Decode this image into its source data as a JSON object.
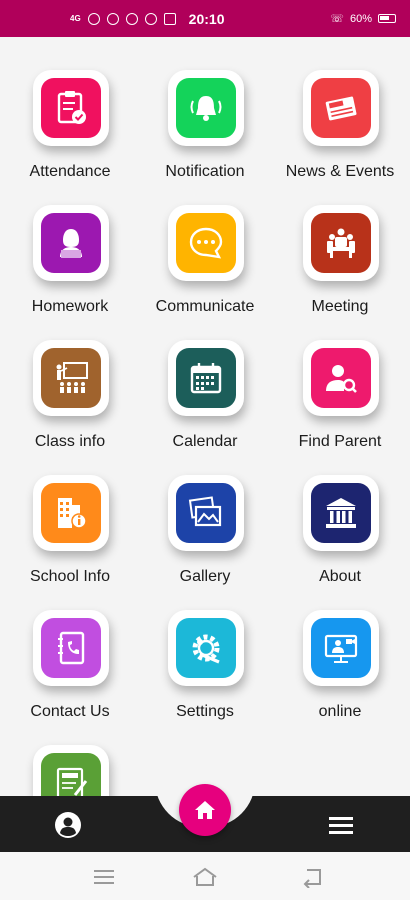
{
  "status_bar": {
    "network": "4G",
    "time": "20:10",
    "battery": "60%"
  },
  "tiles": [
    {
      "label": "Attendance",
      "icon": "attendance-clipboard-icon",
      "color": "#f0115f"
    },
    {
      "label": "Notification",
      "icon": "notification-bell-icon",
      "color": "#14d35a"
    },
    {
      "label": "News & Events",
      "icon": "news-icon",
      "color": "#ef3f44"
    },
    {
      "label": "Homework",
      "icon": "homework-icon",
      "color": "#9c18b0"
    },
    {
      "label": "Communicate",
      "icon": "chat-bubble-icon",
      "color": "#ffb400"
    },
    {
      "label": "Meeting",
      "icon": "meeting-icon",
      "color": "#b8321a"
    },
    {
      "label": "Class info",
      "icon": "class-info-icon",
      "color": "#a0632d"
    },
    {
      "label": "Calendar",
      "icon": "calendar-icon",
      "color": "#1c5e5a"
    },
    {
      "label": "Find Parent",
      "icon": "find-parent-icon",
      "color": "#ee1a6d"
    },
    {
      "label": "School Info",
      "icon": "school-info-icon",
      "color": "#ff8a1a"
    },
    {
      "label": "Gallery",
      "icon": "gallery-icon",
      "color": "#1d43a8"
    },
    {
      "label": "About",
      "icon": "institution-icon",
      "color": "#1d2570"
    },
    {
      "label": "Contact Us",
      "icon": "contact-book-icon",
      "color": "#c14ee0"
    },
    {
      "label": "Settings",
      "icon": "settings-gear-icon",
      "color": "#1cb8d8"
    },
    {
      "label": "online",
      "icon": "online-class-icon",
      "color": "#1697ef"
    },
    {
      "label": "",
      "icon": "test-icon",
      "color": "#5aa036"
    }
  ],
  "bottom_nav": {
    "items": [
      "profile-icon",
      "home-icon",
      "menu-icon"
    ],
    "fab_color": "#e6007e",
    "bar_color": "#1f1f1f"
  },
  "system_nav": [
    "recent-apps-icon",
    "home-outline-icon",
    "back-icon"
  ]
}
